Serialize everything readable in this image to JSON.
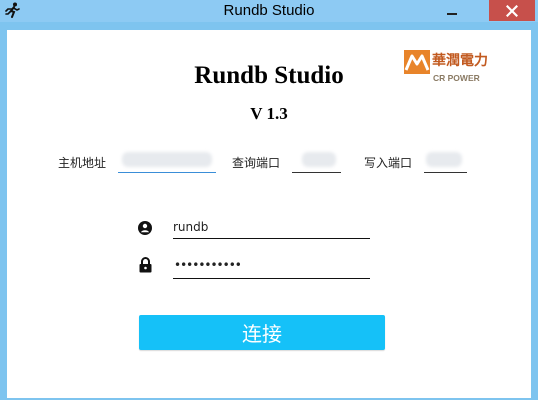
{
  "window": {
    "title": "Rundb Studio",
    "minimize_glyph": "—",
    "close_icon": "close-icon"
  },
  "logo": {
    "cn": "華潤電力",
    "en": "CR POWER"
  },
  "app": {
    "title": "Rundb Studio",
    "version": "V 1.3"
  },
  "config": {
    "host_label": "主机地址",
    "query_port_label": "查询端口",
    "write_port_label": "写入端口"
  },
  "login": {
    "username": "rundb",
    "password_masked": "•••••••••••",
    "connect_label": "连接"
  },
  "colors": {
    "titlebar": "#8dcaf3",
    "close": "#c7504b",
    "accent": "#15c1f8",
    "logo": "#c25a20"
  }
}
